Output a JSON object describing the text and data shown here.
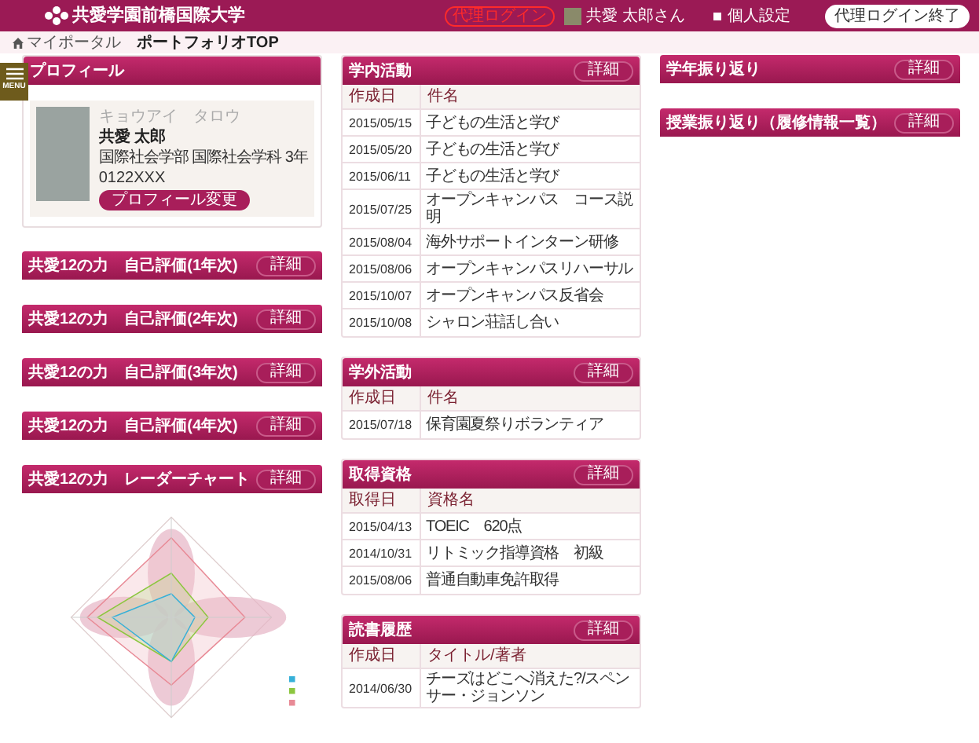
{
  "header": {
    "title": "共愛学園前橋国際大学",
    "proxy_badge": "代理ログイン",
    "user_name": "共愛 太郎さん",
    "settings_label": "個人設定",
    "end_proxy_button": "代理ログイン終了"
  },
  "breadcrumb": [
    {
      "label": "マイポータル"
    },
    {
      "label": "ポートフォリオTOP"
    }
  ],
  "menu_tab": {
    "label": "MENU"
  },
  "left_column": {
    "profile": {
      "title": "プロフィール",
      "kana": "キョウアイ　タロウ",
      "name": "共愛 太郎",
      "affiliation": "国際社会学部 国際社会学科 3年",
      "student_id": "0122XXX",
      "button": "プロフィール変更"
    },
    "sections": [
      {
        "title": "共愛12の力　自己評価(1年次)",
        "button": "詳細"
      },
      {
        "title": "共愛12の力　自己評価(2年次)",
        "button": "詳細"
      },
      {
        "title": "共愛12の力　自己評価(3年次)",
        "button": "詳細"
      },
      {
        "title": "共愛12の力　自己評価(4年次)",
        "button": "詳細"
      }
    ],
    "radar": {
      "title": "共愛12の力　レーダーチャート",
      "button": "詳細"
    }
  },
  "middle_column": [
    {
      "title": "学内活動",
      "button": "詳細",
      "columns": [
        "作成日",
        "件名"
      ],
      "rows": [
        [
          "2015/05/15",
          "子どもの生活と学び"
        ],
        [
          "2015/05/20",
          "子どもの生活と学び"
        ],
        [
          "2015/06/11",
          "子どもの生活と学び"
        ],
        [
          "2015/07/25",
          "オープンキャンパス　コース説明"
        ],
        [
          "2015/08/04",
          "海外サポートインターン研修"
        ],
        [
          "2015/08/06",
          "オープンキャンパスリハーサル"
        ],
        [
          "2015/10/07",
          "オープンキャンパス反省会"
        ],
        [
          "2015/10/08",
          "シャロン荘話し合い"
        ]
      ]
    },
    {
      "title": "学外活動",
      "button": "詳細",
      "columns": [
        "作成日",
        "件名"
      ],
      "rows": [
        [
          "2015/07/18",
          "保育園夏祭りボランティア"
        ]
      ]
    },
    {
      "title": "取得資格",
      "button": "詳細",
      "columns": [
        "取得日",
        "資格名"
      ],
      "rows": [
        [
          "2015/04/13",
          "TOEIC　620点"
        ],
        [
          "2014/10/31",
          "リトミック指導資格　初級"
        ],
        [
          "2015/08/06",
          "普通自動車免許取得"
        ]
      ]
    },
    {
      "title": "読書履歴",
      "button": "詳細",
      "columns": [
        "作成日",
        "タイトル/著者"
      ],
      "rows": [
        [
          "2014/06/30",
          "チーズはどこへ消えた?/スペンサー・ジョンソン"
        ]
      ]
    }
  ],
  "right_column": [
    {
      "title": "学年振り返り",
      "button": "詳細"
    },
    {
      "title": "授業振り返り（履修情報一覧）",
      "button": "詳細"
    }
  ]
}
